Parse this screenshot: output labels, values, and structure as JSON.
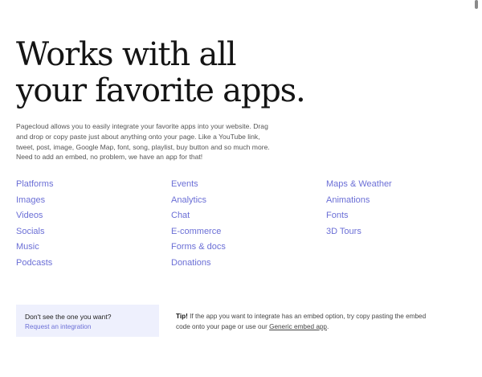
{
  "hero": {
    "title": "Works with all your favorite apps.",
    "description": "Pagecloud allows you to easily integrate your favorite apps into your website. Drag and drop or copy paste just about anything onto your page. Like a YouTube link, tweet, post, image, Google Map, font, song, playlist, buy button and so much more. Need to add an embed, no problem, we have an app for that!"
  },
  "categories": {
    "col1": [
      "Platforms",
      "Images",
      "Videos",
      "Socials",
      "Music",
      "Podcasts"
    ],
    "col2": [
      "Events",
      "Analytics",
      "Chat",
      "E-commerce",
      "Forms & docs",
      "Donations"
    ],
    "col3": [
      "Maps & Weather",
      "Animations",
      "Fonts",
      "3D Tours"
    ]
  },
  "request": {
    "question": "Don't see the one you want?",
    "link": "Request an integration"
  },
  "tip": {
    "label": "Tip!",
    "text_before": " If the app you want to integrate has an embed option, try copy pasting the embed code onto your page or use our ",
    "link": "Generic embed app",
    "text_after": "."
  },
  "colors": {
    "accent": "#6b6fd6",
    "request_box_bg": "#eef0fd",
    "title": "#141414"
  }
}
